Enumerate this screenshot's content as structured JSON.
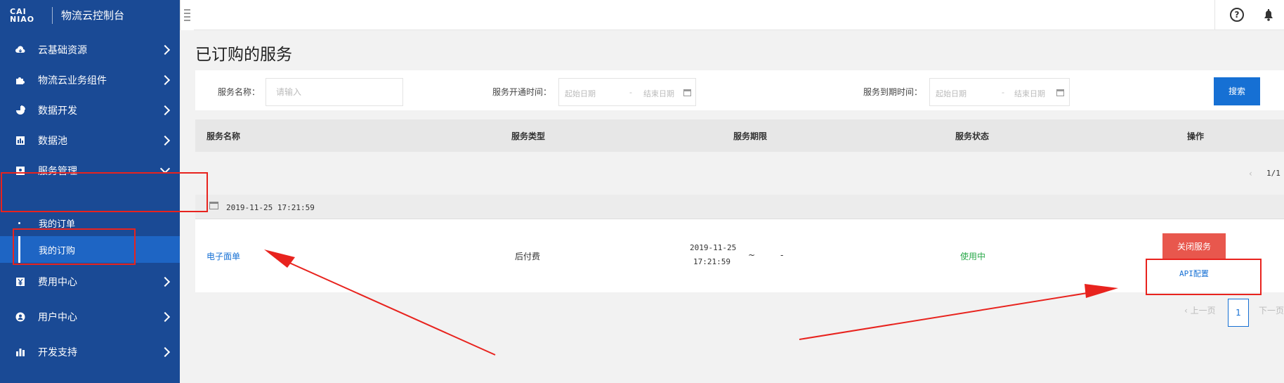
{
  "brand": {
    "logo_line1": "CAI",
    "logo_line2": "NIAO",
    "title": "物流云控制台"
  },
  "sidebar": {
    "items": [
      {
        "label": "云基础资源",
        "icon": "cloud-icon"
      },
      {
        "label": "物流云业务组件",
        "icon": "puzzle-icon"
      },
      {
        "label": "数据开发",
        "icon": "pie-chart-icon"
      },
      {
        "label": "数据池",
        "icon": "bar-chart-icon"
      },
      {
        "label": "服务管理",
        "icon": "service-icon",
        "expanded": true
      },
      {
        "label": "费用中心",
        "icon": "yen-icon"
      },
      {
        "label": "用户中心",
        "icon": "user-icon"
      },
      {
        "label": "开发支持",
        "icon": "dev-chart-icon"
      }
    ],
    "sub_items": [
      {
        "label": "我的订单"
      },
      {
        "label": "我的订购",
        "active": true
      }
    ]
  },
  "page": {
    "title": "已订购的服务"
  },
  "filter": {
    "service_name_label": "服务名称：",
    "service_name_placeholder": "请输入",
    "open_time_label": "服务开通时间：",
    "expire_time_label": "服务到期时间：",
    "start_placeholder": "起始日期",
    "end_placeholder": "结束日期",
    "range_sep": "-",
    "search_label": "搜索"
  },
  "table": {
    "headers": [
      "服务名称",
      "服务类型",
      "服务期限",
      "服务状态",
      "操作"
    ],
    "top_pager": "1/1",
    "group_time": "2019-11-25 17:21:59",
    "rows": [
      {
        "name": "电子面单",
        "type": "后付费",
        "period_start_date": "2019-11-25",
        "period_start_time": "17:21:59",
        "period_sep": "~",
        "period_end": "-",
        "status": "使用中",
        "close_action": "关闭服务",
        "api_action": "API配置"
      }
    ]
  },
  "pagination": {
    "prev": "上一页",
    "current": "1",
    "next": "下一页"
  },
  "colors": {
    "sidebar": "#1a4a95",
    "active": "#1e65c4",
    "primary": "#1670d4",
    "danger": "#e8574d",
    "status_ok": "#2aa84a",
    "annotation": "#e8231e"
  }
}
